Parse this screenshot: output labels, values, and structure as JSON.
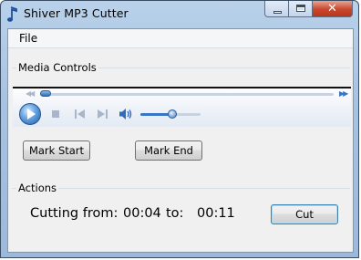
{
  "window": {
    "title": "Shiver MP3 Cutter",
    "close_glyph": "✕"
  },
  "menu": {
    "file": "File"
  },
  "media_controls": {
    "label": "Media Controls",
    "seek_position_fraction": 0.0,
    "volume_fraction": 0.5,
    "rewind_glyph": "◀◀",
    "forward_glyph": "▶▶"
  },
  "marks": {
    "start_label": "Mark Start",
    "end_label": "Mark End"
  },
  "actions": {
    "label": "Actions",
    "cutting_from_label": "Cutting from:",
    "from_time": "00:04",
    "to_label": "to:",
    "to_time": "00:11",
    "cut_label": "Cut"
  },
  "icons": [
    "app-note-icon",
    "minimize-icon",
    "maximize-icon",
    "close-icon",
    "rewind-icon",
    "fast-forward-icon",
    "play-icon",
    "stop-icon",
    "previous-icon",
    "next-icon",
    "volume-icon"
  ]
}
